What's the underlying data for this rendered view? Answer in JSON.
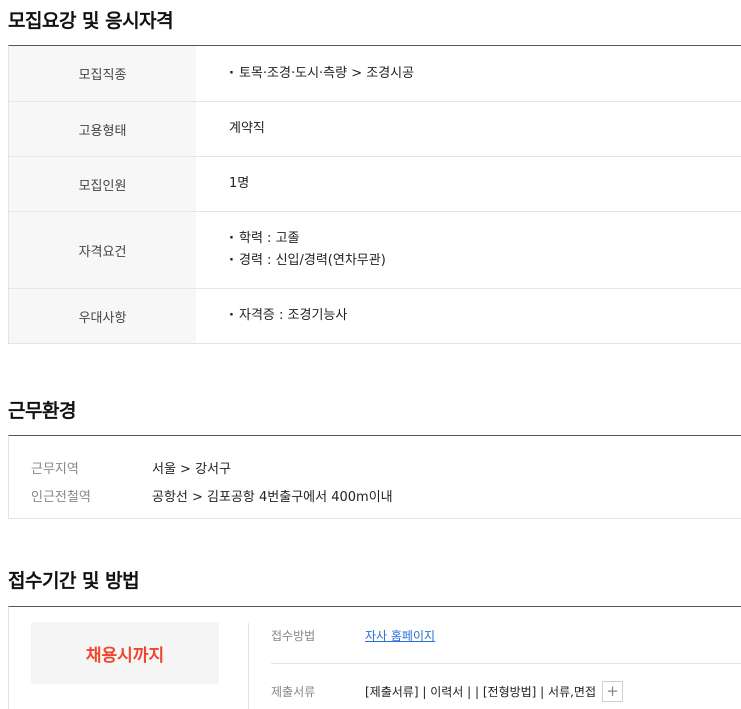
{
  "recruit": {
    "title": "모집요강 및 응시자격",
    "rows": [
      {
        "label": "모집직종",
        "items": [
          "토목·조경·도시·측량 > 조경시공"
        ]
      },
      {
        "label": "고용형태",
        "value": "계약직"
      },
      {
        "label": "모집인원",
        "value": "1명"
      },
      {
        "label": "자격요건",
        "items": [
          "학력 : 고졸",
          "경력 : 신입/경력(연차무관)"
        ]
      },
      {
        "label": "우대사항",
        "items": [
          "자격증 : 조경기능사"
        ]
      }
    ]
  },
  "environment": {
    "title": "근무환경",
    "location_label": "근무지역",
    "location_value": "서울 > 강서구",
    "subway_label": "인근전철역",
    "subway_value": "공항선 > 김포공항 4번출구에서 400m이내"
  },
  "application": {
    "title": "접수기간 및 방법",
    "deadline": "채용시까지",
    "method_label": "접수방법",
    "method_value": "자사 홈페이지",
    "docs_label": "제출서류",
    "docs_value": "[제출서류] | 이력서 | | [전형방법] | 서류,면접",
    "plus_symbol": "+"
  }
}
